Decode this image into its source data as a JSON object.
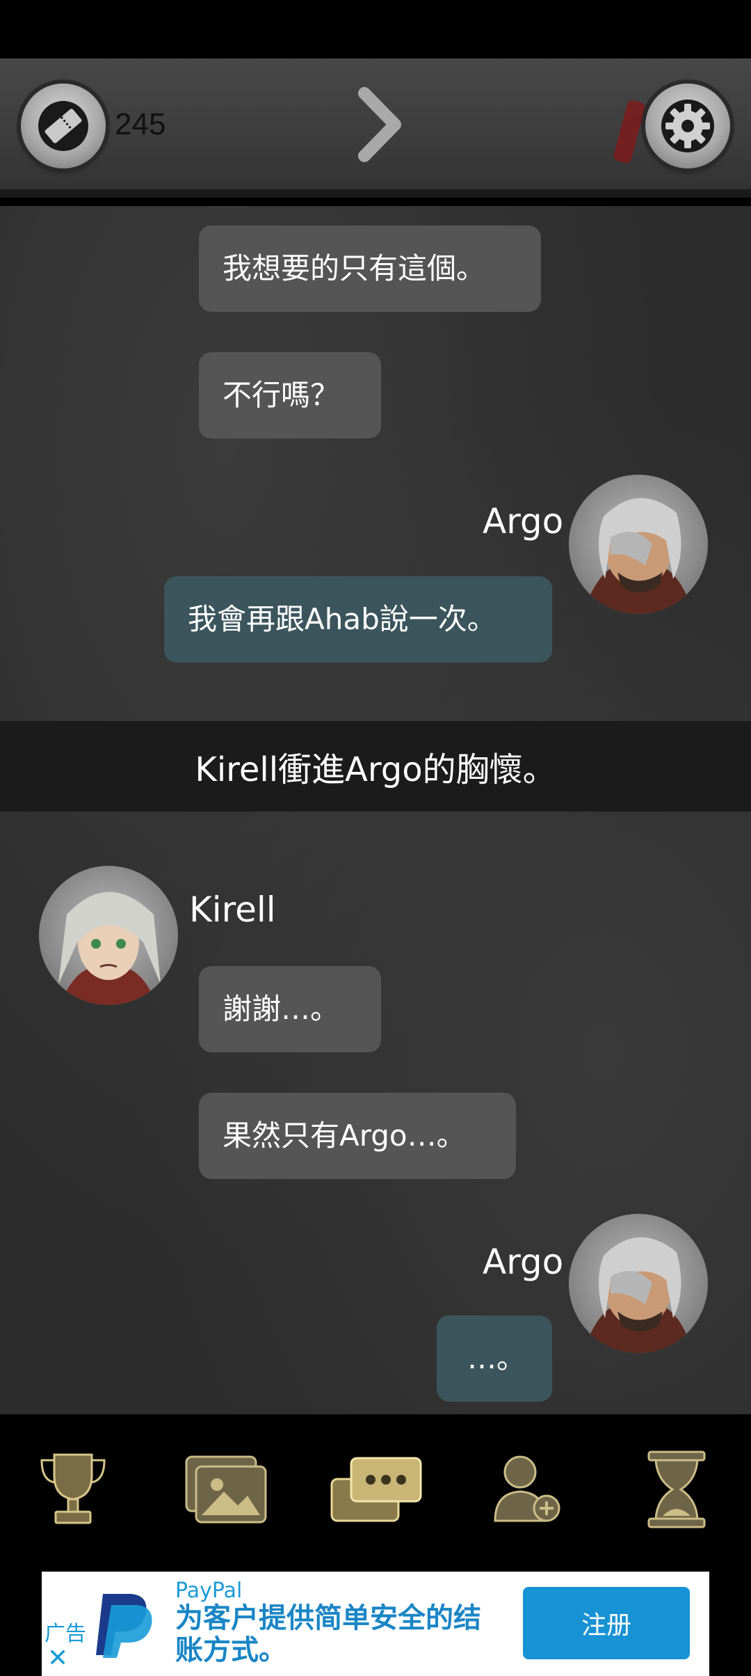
{
  "header": {
    "ticket_count": "245",
    "ticket_icon": "ticket-icon",
    "next_icon": "chevron-right-icon",
    "settings_icon": "gear-icon"
  },
  "chat": {
    "messages": [
      {
        "text": "我想要的只有這個。"
      },
      {
        "text": "不行嗎？"
      },
      {
        "speaker": "Argo",
        "text": "我會再跟Ahab說一次。"
      },
      {
        "speaker": "Kirell",
        "text": "謝謝…。"
      },
      {
        "text": "果然只有Argo…。"
      },
      {
        "speaker": "Argo",
        "text": "…。"
      }
    ],
    "narration": "Kirell衝進Argo的胸懷。"
  },
  "nav": {
    "items": [
      {
        "icon": "trophy-icon"
      },
      {
        "icon": "gallery-icon"
      },
      {
        "icon": "chat-icon"
      },
      {
        "icon": "add-user-icon"
      },
      {
        "icon": "hourglass-icon"
      }
    ]
  },
  "ad": {
    "tag": "广告",
    "brand": "PayPal",
    "text": "为客户提供简单安全的结账方式。",
    "cta": "注册",
    "close": "✕"
  },
  "colors": {
    "bubble_gray": "#555555",
    "bubble_teal": "#3c555d",
    "icon_gold": "#d6c68a",
    "ad_blue": "#1792d4"
  }
}
